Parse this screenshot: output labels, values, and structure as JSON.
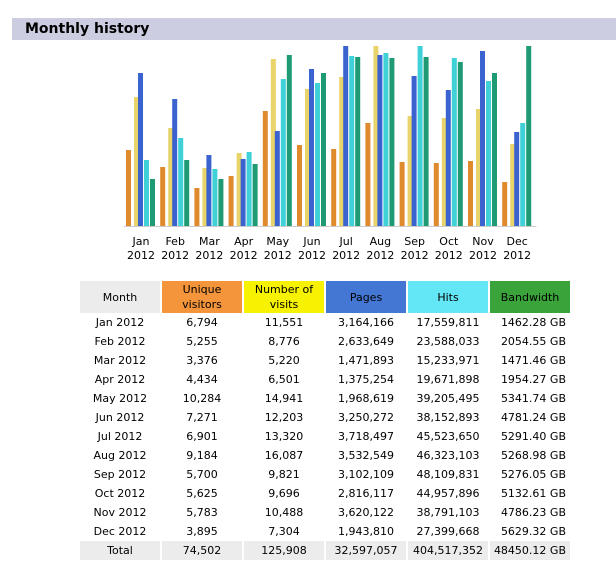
{
  "section": {
    "title": "Monthly history"
  },
  "table": {
    "headers": {
      "month": "Month",
      "unique": "Unique visitors",
      "visits": "Number of visits",
      "pages": "Pages",
      "hits": "Hits",
      "bandwidth": "Bandwidth"
    },
    "rows": [
      {
        "month": "Jan 2012",
        "unique": "6,794",
        "visits": "11,551",
        "pages": "3,164,166",
        "hits": "17,559,811",
        "bandwidth": "1462.28 GB"
      },
      {
        "month": "Feb 2012",
        "unique": "5,255",
        "visits": "8,776",
        "pages": "2,633,649",
        "hits": "23,588,033",
        "bandwidth": "2054.55 GB"
      },
      {
        "month": "Mar 2012",
        "unique": "3,376",
        "visits": "5,220",
        "pages": "1,471,893",
        "hits": "15,233,971",
        "bandwidth": "1471.46 GB"
      },
      {
        "month": "Apr 2012",
        "unique": "4,434",
        "visits": "6,501",
        "pages": "1,375,254",
        "hits": "19,671,898",
        "bandwidth": "1954.27 GB"
      },
      {
        "month": "May 2012",
        "unique": "10,284",
        "visits": "14,941",
        "pages": "1,968,619",
        "hits": "39,205,495",
        "bandwidth": "5341.74 GB"
      },
      {
        "month": "Jun 2012",
        "unique": "7,271",
        "visits": "12,203",
        "pages": "3,250,272",
        "hits": "38,152,893",
        "bandwidth": "4781.24 GB"
      },
      {
        "month": "Jul 2012",
        "unique": "6,901",
        "visits": "13,320",
        "pages": "3,718,497",
        "hits": "45,523,650",
        "bandwidth": "5291.40 GB"
      },
      {
        "month": "Aug 2012",
        "unique": "9,184",
        "visits": "16,087",
        "pages": "3,532,549",
        "hits": "46,323,103",
        "bandwidth": "5268.98 GB"
      },
      {
        "month": "Sep 2012",
        "unique": "5,700",
        "visits": "9,821",
        "pages": "3,102,109",
        "hits": "48,109,831",
        "bandwidth": "5276.05 GB"
      },
      {
        "month": "Oct 2012",
        "unique": "5,625",
        "visits": "9,696",
        "pages": "2,816,117",
        "hits": "44,957,896",
        "bandwidth": "5132.61 GB"
      },
      {
        "month": "Nov 2012",
        "unique": "5,783",
        "visits": "10,488",
        "pages": "3,620,122",
        "hits": "38,791,103",
        "bandwidth": "4786.23 GB"
      },
      {
        "month": "Dec 2012",
        "unique": "3,895",
        "visits": "7,304",
        "pages": "1,943,810",
        "hits": "27,399,668",
        "bandwidth": "5629.32 GB"
      }
    ],
    "total": {
      "month": "Total",
      "unique": "74,502",
      "visits": "125,908",
      "pages": "32,597,057",
      "hits": "404,517,352",
      "bandwidth": "48450.12 GB"
    }
  },
  "chart_data": {
    "type": "bar",
    "categories": [
      "Jan",
      "Feb",
      "Mar",
      "Apr",
      "May",
      "Jun",
      "Jul",
      "Aug",
      "Sep",
      "Oct",
      "Nov",
      "Dec"
    ],
    "year_labels": [
      "2012",
      "2012",
      "2012",
      "2012",
      "2012",
      "2012",
      "2012",
      "2012",
      "2012",
      "2012",
      "2012",
      "2012"
    ],
    "series": [
      {
        "name": "Unique visitors",
        "color": "#e08a2e",
        "values": [
          6794,
          5255,
          3376,
          4434,
          10284,
          7271,
          6901,
          9184,
          5700,
          5625,
          5783,
          3895
        ]
      },
      {
        "name": "Number of visits",
        "color": "#e8d46a",
        "values": [
          11551,
          8776,
          5220,
          6501,
          14941,
          12203,
          13320,
          16087,
          9821,
          9696,
          10488,
          7304
        ]
      },
      {
        "name": "Pages",
        "color": "#3b63d0",
        "values": [
          3164166,
          2633649,
          1471893,
          1375254,
          1968619,
          3250272,
          3718497,
          3532549,
          3102109,
          2816117,
          3620122,
          1943810
        ]
      },
      {
        "name": "Hits",
        "color": "#3fd0d8",
        "values": [
          17559811,
          23588033,
          15233971,
          19671898,
          39205495,
          38152893,
          45523650,
          46323103,
          48109831,
          44957896,
          38791103,
          27399668
        ]
      },
      {
        "name": "Bandwidth",
        "color": "#1e9a75",
        "unit": "GB",
        "values": [
          1462.28,
          2054.55,
          1471.46,
          1954.27,
          5341.74,
          4781.24,
          5291.4,
          5268.98,
          5276.05,
          5132.61,
          4786.23,
          5629.32
        ]
      }
    ],
    "grid": false,
    "legend": "none"
  }
}
